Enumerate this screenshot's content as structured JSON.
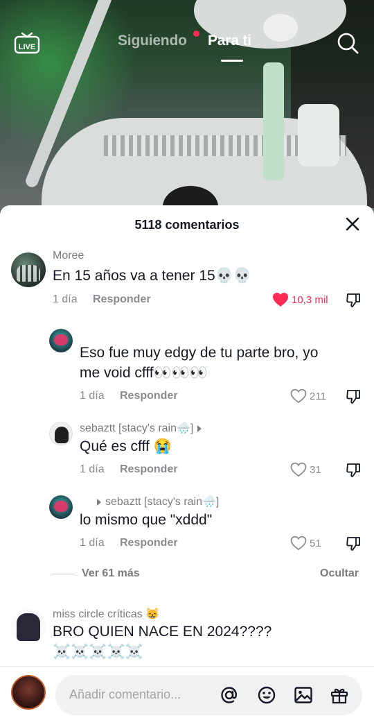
{
  "nav": {
    "live_label": "LIVE",
    "following": "Siguiendo",
    "for_you": "Para ti"
  },
  "sheet": {
    "title": "5118 comentarios"
  },
  "comments": [
    {
      "username": "Moree",
      "text": "En 15 años va a tener 15💀💀",
      "time": "1 día",
      "reply": "Responder",
      "likes": "10,3 mil",
      "liked": true
    },
    {
      "username": "",
      "text_line1": "Eso fue muy edgy de tu parte bro, yo",
      "text_line2": "me void cfff👀👀👀",
      "time": "1 día",
      "reply": "Responder",
      "likes": "211"
    },
    {
      "username": "sebaztt [stacy's rain🌧️]",
      "text": "Qué es cfff 😭",
      "time": "1 día",
      "reply": "Responder",
      "likes": "31"
    },
    {
      "reply_to": "sebaztt [stacy's rain🌧️]",
      "text": "lo mismo que \"xddd\"",
      "time": "1 día",
      "reply": "Responder",
      "likes": "51"
    }
  ],
  "thread": {
    "view_more": "Ver 61 más",
    "hide": "Ocultar"
  },
  "next_comment": {
    "username": "miss circle críticas 😸",
    "text_line1": "BRO QUIEN NACE EN 2024????",
    "text_line2": "☠️☠️☠️☠️☠️"
  },
  "composer": {
    "placeholder": "Añadir comentario...",
    "icons": [
      "at-icon",
      "emoji-icon",
      "image-icon",
      "gift-icon"
    ]
  },
  "colors": {
    "accent": "#fe2c55",
    "text": "#161823",
    "muted": "#8a8b91"
  }
}
